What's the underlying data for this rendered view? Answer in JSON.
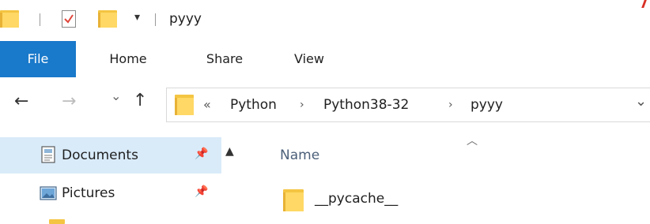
{
  "window": {
    "title": "pyyy"
  },
  "ribbon": {
    "tabs": [
      {
        "label": "File"
      },
      {
        "label": "Home"
      },
      {
        "label": "Share"
      },
      {
        "label": "View"
      }
    ]
  },
  "address_bar": {
    "overflow_glyph": "«",
    "crumbs": [
      {
        "label": "Python"
      },
      {
        "label": "Python38-32"
      },
      {
        "label": "pyyy"
      }
    ],
    "separator": "›",
    "dropdown_glyph": "⌄"
  },
  "nav_glyphs": {
    "back": "←",
    "forward": "→",
    "recent": "⌄",
    "up": "↑"
  },
  "nav_pane": {
    "items": [
      {
        "label": "Documents",
        "icon": "documents-icon",
        "pinned": true,
        "selected": true
      },
      {
        "label": "Pictures",
        "icon": "pictures-icon",
        "pinned": true,
        "selected": false
      }
    ]
  },
  "file_list": {
    "columns": [
      {
        "label": "Name"
      }
    ],
    "items": [
      {
        "name": "__pycache__",
        "icon": "folder-icon"
      }
    ]
  },
  "colors": {
    "file_tab": "#1979ca",
    "selection": "#d9ebf9",
    "folder": "#ffd865"
  }
}
